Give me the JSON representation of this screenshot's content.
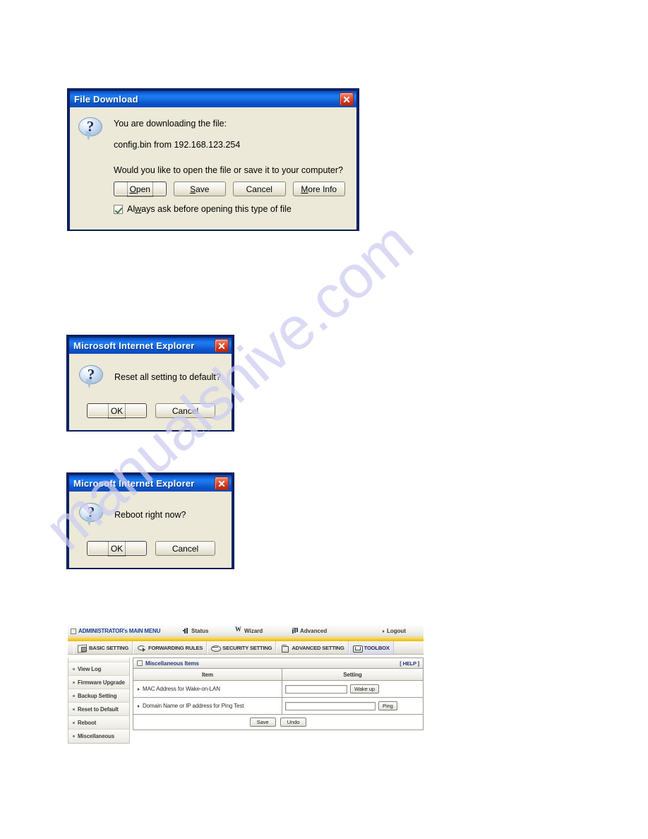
{
  "watermark": {
    "text": "manualshive.com"
  },
  "dialogs": [
    {
      "id": "file-download",
      "title": "File Download",
      "icon": "question-balloon-icon",
      "close_label": "Close",
      "line1": "You are downloading the file:",
      "line2": "config.bin from 192.168.123.254",
      "line3": "Would you like to open the file or save it to your computer?",
      "buttons": [
        {
          "label": "Open",
          "accel": "O",
          "default": true
        },
        {
          "label": "Save",
          "accel": "S",
          "default": false
        },
        {
          "label": "Cancel",
          "accel": "",
          "default": false
        },
        {
          "label": "More Info",
          "accel": "M",
          "default": false
        }
      ],
      "checkbox": {
        "label": "Always ask before opening this type of file",
        "checked": true,
        "accel": "w"
      }
    },
    {
      "id": "reset-confirm",
      "title": "Microsoft Internet Explorer",
      "icon": "question-balloon-icon",
      "close_label": "Close",
      "message": "Reset all setting to default?",
      "buttons": [
        {
          "label": "OK",
          "default": true
        },
        {
          "label": "Cancel",
          "default": false
        }
      ]
    },
    {
      "id": "reboot-confirm",
      "title": "Microsoft Internet Explorer",
      "icon": "question-balloon-icon",
      "close_label": "Close",
      "message": "Reboot right now?",
      "buttons": [
        {
          "label": "OK",
          "default": true
        },
        {
          "label": "Cancel",
          "default": false
        }
      ]
    }
  ],
  "router": {
    "topbar": {
      "main_menu": "ADMINISTRATOR's MAIN MENU",
      "links": [
        {
          "label": "Status",
          "icon": "status-bars-icon"
        },
        {
          "label": "Wizard",
          "icon": "wizard-wand-icon"
        },
        {
          "label": "Advanced",
          "icon": "advanced-chart-icon"
        },
        {
          "label": "Logout",
          "icon": "arrow-right-icon"
        }
      ]
    },
    "tabs": [
      {
        "label": "BASIC SETTING",
        "icon": "book-icon",
        "active": false
      },
      {
        "label": "FORWARDING RULES",
        "icon": "arrows-icon",
        "active": false
      },
      {
        "label": "SECURITY SETTING",
        "icon": "shield-icon",
        "active": false
      },
      {
        "label": "ADVANCED SETTING",
        "icon": "hat-icon",
        "active": false
      },
      {
        "label": "TOOLBOX",
        "icon": "tools-icon",
        "active": true
      }
    ],
    "sidebar": [
      {
        "label": "View Log"
      },
      {
        "label": "Firmware Upgrade"
      },
      {
        "label": "Backup Setting"
      },
      {
        "label": "Reset to Default"
      },
      {
        "label": "Reboot"
      },
      {
        "label": "Miscellaneous"
      }
    ],
    "panel": {
      "title": "Miscellaneous Items",
      "help": "[ HELP ]",
      "columns": [
        "Item",
        "Setting"
      ],
      "rows": [
        {
          "item": "MAC Address for Wake-on-LAN",
          "input_value": "",
          "input_placeholder": "",
          "button": "Wake up"
        },
        {
          "item": "Domain Name or IP address for Ping Test",
          "input_value": "",
          "input_placeholder": "",
          "button": "Ping"
        }
      ],
      "footer_buttons": [
        "Save",
        "Undo"
      ]
    }
  }
}
